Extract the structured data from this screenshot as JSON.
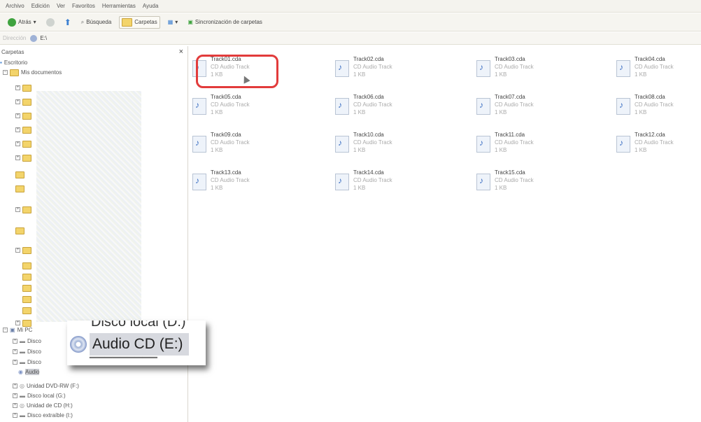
{
  "menu": [
    "Archivo",
    "Edición",
    "Ver",
    "Favoritos",
    "Herramientas",
    "Ayuda"
  ],
  "toolbar": {
    "back_label": "Atrás",
    "search_label": "Búsqueda",
    "folders_label": "Carpetas",
    "sync_label": "Sincronización de carpetas"
  },
  "address": {
    "label": "Dirección",
    "value": "E:\\"
  },
  "folders_panel": {
    "title": "Carpetas",
    "close": "×"
  },
  "tree": [
    {
      "label": "Escritorio"
    },
    {
      "label": "Mis documentos"
    },
    {
      "label": "Mi PC"
    },
    {
      "label": "Disco"
    },
    {
      "label": "Disco"
    },
    {
      "label": "Disco"
    },
    {
      "label": "Audio"
    },
    {
      "label": "Unidad DVD-RW (F:)"
    },
    {
      "label": "Disco local (G:)"
    },
    {
      "label": "Unidad de CD (H:)"
    },
    {
      "label": "Disco extraíble (I:)"
    }
  ],
  "zoom_callout": {
    "previous": "Disco local (D:)",
    "current": "Audio CD (E:)"
  },
  "files": [
    {
      "name": "Track01.cda",
      "type": "CD Audio Track",
      "size": "1 KB"
    },
    {
      "name": "Track02.cda",
      "type": "CD Audio Track",
      "size": "1 KB"
    },
    {
      "name": "Track03.cda",
      "type": "CD Audio Track",
      "size": "1 KB"
    },
    {
      "name": "Track04.cda",
      "type": "CD Audio Track",
      "size": "1 KB"
    },
    {
      "name": "Track05.cda",
      "type": "CD Audio Track",
      "size": "1 KB"
    },
    {
      "name": "Track06.cda",
      "type": "CD Audio Track",
      "size": "1 KB"
    },
    {
      "name": "Track07.cda",
      "type": "CD Audio Track",
      "size": "1 KB"
    },
    {
      "name": "Track08.cda",
      "type": "CD Audio Track",
      "size": "1 KB"
    },
    {
      "name": "Track09.cda",
      "type": "CD Audio Track",
      "size": "1 KB"
    },
    {
      "name": "Track10.cda",
      "type": "CD Audio Track",
      "size": "1 KB"
    },
    {
      "name": "Track11.cda",
      "type": "CD Audio Track",
      "size": "1 KB"
    },
    {
      "name": "Track12.cda",
      "type": "CD Audio Track",
      "size": "1 KB"
    },
    {
      "name": "Track13.cda",
      "type": "CD Audio Track",
      "size": "1 KB"
    },
    {
      "name": "Track14.cda",
      "type": "CD Audio Track",
      "size": "1 KB"
    },
    {
      "name": "Track15.cda",
      "type": "CD Audio Track",
      "size": "1 KB"
    }
  ],
  "colors": {
    "highlight": "#e23b3b",
    "folder": "#f3d46b"
  }
}
